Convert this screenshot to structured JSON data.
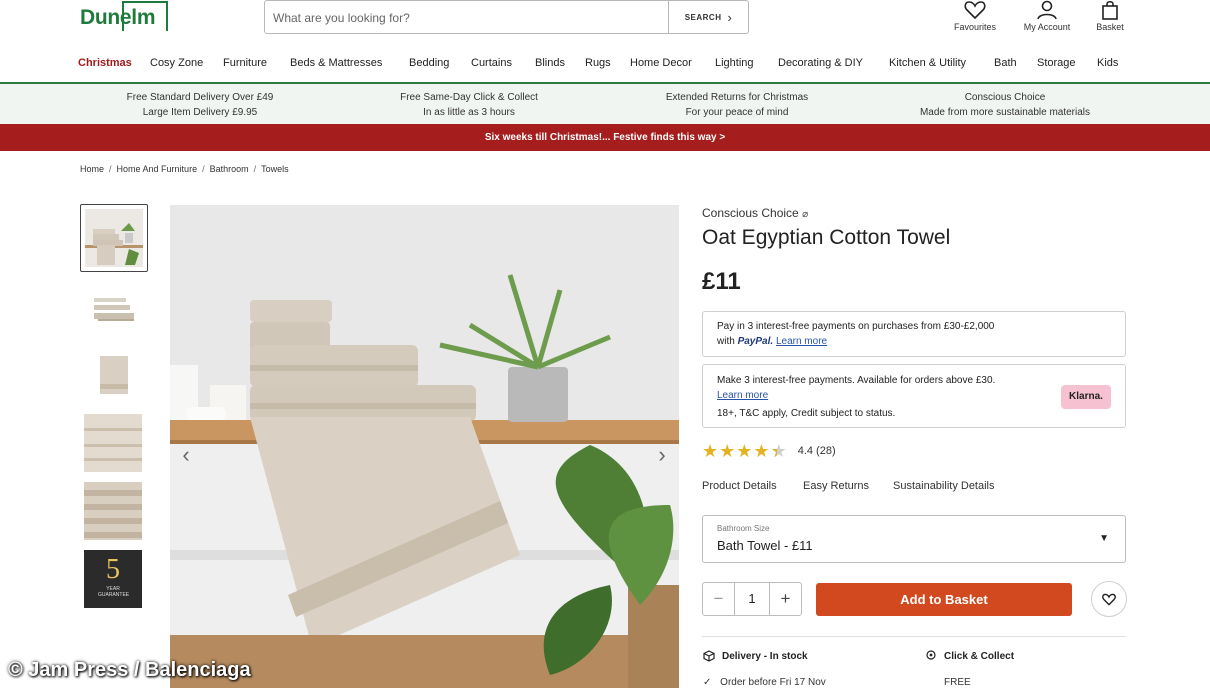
{
  "header": {
    "logo_text": "Dunelm",
    "search_placeholder": "What are you looking for?",
    "search_button": "SEARCH",
    "favourites_label": "Favourites",
    "account_label": "My Account",
    "basket_label": "Basket"
  },
  "nav": {
    "items": [
      "Christmas",
      "Cosy Zone",
      "Furniture",
      "Beds & Mattresses",
      "Bedding",
      "Curtains",
      "Blinds",
      "Rugs",
      "Home Decor",
      "Lighting",
      "Decorating & DIY",
      "Kitchen & Utility",
      "Bath",
      "Storage",
      "Kids"
    ]
  },
  "usp": [
    {
      "line1": "Free Standard Delivery Over £49",
      "line2": "Large Item Delivery £9.95"
    },
    {
      "line1": "Free Same-Day Click & Collect",
      "line2": "In as little as 3 hours"
    },
    {
      "line1": "Extended Returns for Christmas",
      "line2": "For your peace of mind"
    },
    {
      "line1": "Conscious Choice",
      "line2": "Made from more sustainable materials"
    }
  ],
  "promo_banner": "Six weeks till Christmas!... Festive finds this way >",
  "breadcrumb": [
    "Home",
    "Home And Furniture",
    "Bathroom",
    "Towels"
  ],
  "thumbnails": {
    "guarantee_number": "5",
    "guarantee_text": "YEAR GUARANTEE"
  },
  "product": {
    "brandline": "Conscious Choice",
    "title": "Oat Egyptian Cotton Towel",
    "price": "£11",
    "paypal": {
      "line1": "Pay in 3 interest-free payments on purchases from £30-£2,000",
      "with": "with",
      "brand": "PayPal.",
      "learn_more": "Learn more"
    },
    "klarna": {
      "line1": "Make 3 interest-free payments. Available for orders above £30.",
      "learn_more": "Learn more",
      "line3": "18+, T&C apply, Credit subject to status.",
      "badge": "Klarna."
    },
    "rating": {
      "value": 4.4,
      "text": "4.4 (28)"
    },
    "tabs": [
      "Product Details",
      "Easy Returns",
      "Sustainability Details"
    ],
    "size_select": {
      "label": "Bathroom Size",
      "value": "Bath Towel - £11"
    },
    "quantity": "1",
    "add_to_basket": "Add to Basket",
    "delivery": {
      "label": "Delivery - In stock",
      "sub": "Order before Fri 17 Nov"
    },
    "collect": {
      "label": "Click & Collect",
      "sub": "FREE"
    }
  },
  "watermark": "© Jam Press / Balenciaga",
  "colors": {
    "brand_green": "#1f7a3c",
    "promo_red": "#a51d1d",
    "add_button": "#d3491f",
    "star": "#e3b324"
  }
}
